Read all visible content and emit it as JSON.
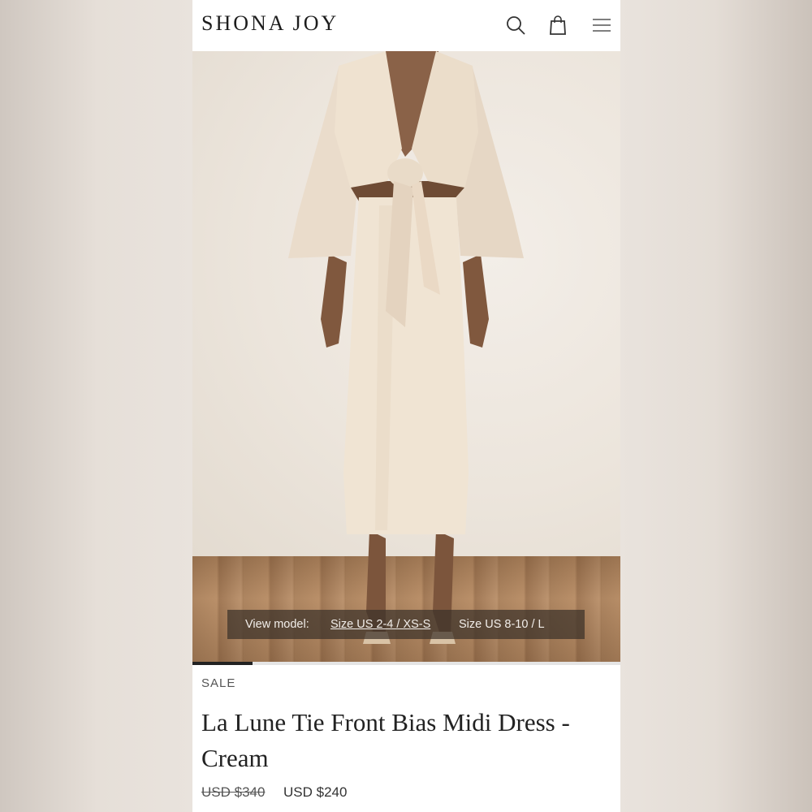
{
  "header": {
    "logo": "SHONA JOY",
    "icons": [
      "search-icon",
      "bag-icon",
      "menu-icon"
    ]
  },
  "gallery": {
    "view_model_label": "View model:",
    "size_options": [
      "Size US 2-4 / XS-S",
      "Size US 8-10 / L"
    ],
    "selected_size": "Size US 2-4 / XS-S",
    "progress": 0.14
  },
  "product": {
    "badge": "SALE",
    "title": "La Lune Tie Front Bias Midi Dress - Cream",
    "price_original": "USD $340",
    "price_sale": "USD $240"
  },
  "colors": {
    "background": "#e9e3dd",
    "text": "#222222",
    "dress": "#efe2cf"
  }
}
